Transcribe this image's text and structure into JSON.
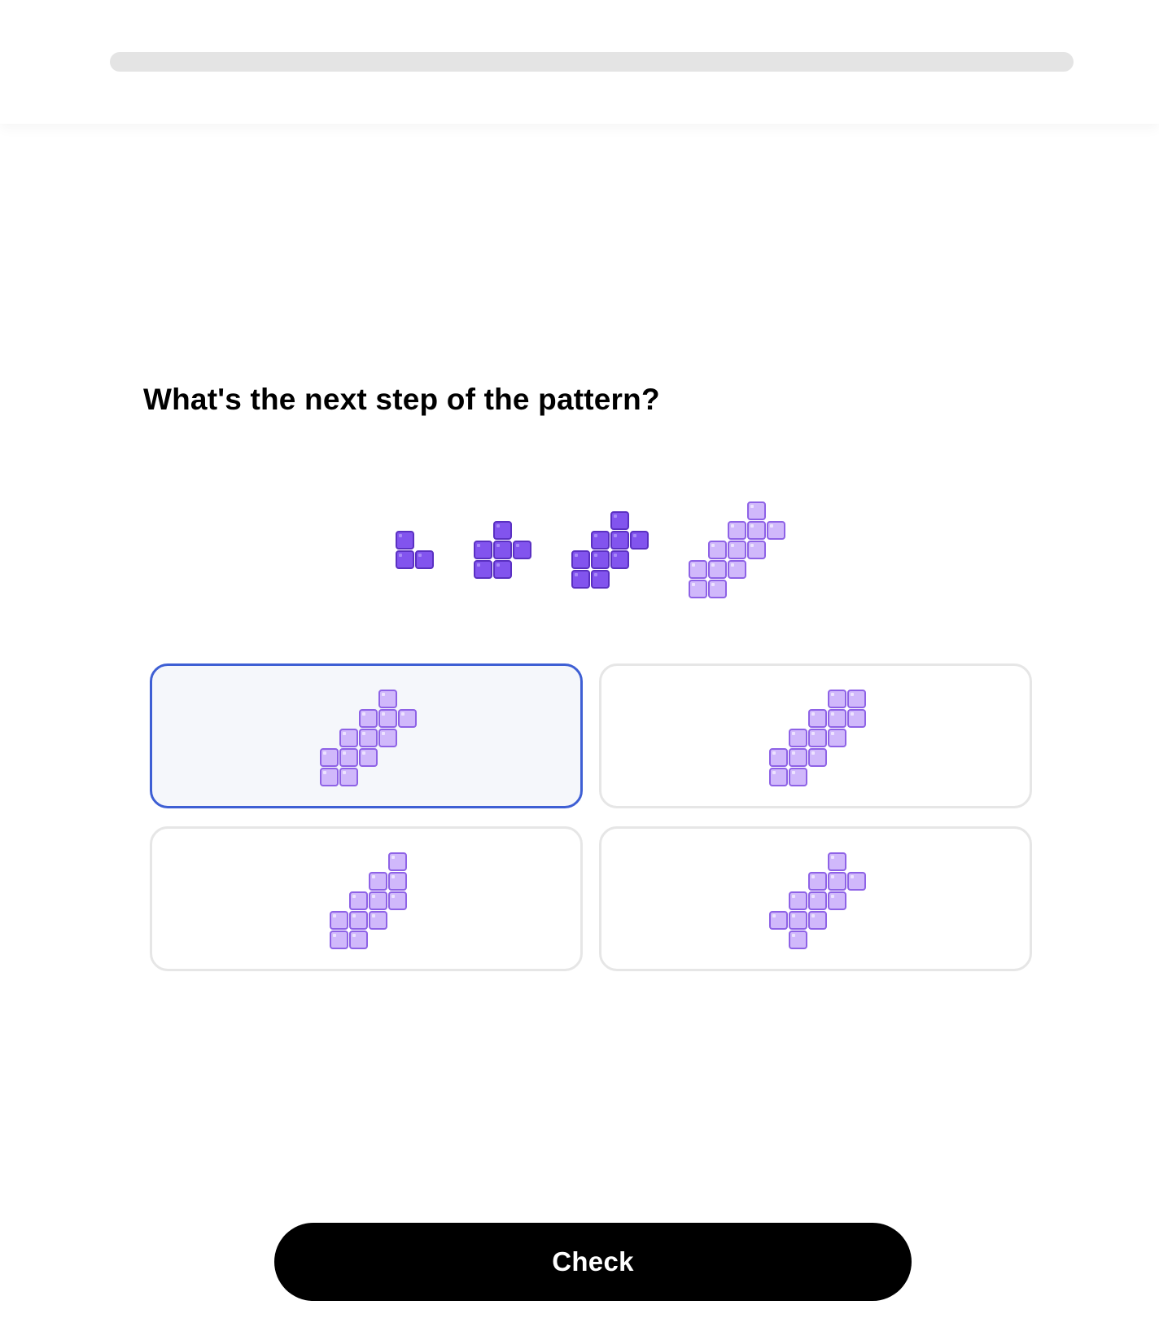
{
  "progress": {
    "fraction": 0
  },
  "question": {
    "text": "What's the next step of the pattern?"
  },
  "colors": {
    "dark_block": "#8254ee",
    "light_block": "#d0b8fb",
    "selected_border": "#3e5fd4"
  },
  "pattern": {
    "steps": [
      {
        "style": "dark",
        "cells": [
          [
            0,
            0
          ],
          [
            0,
            1
          ],
          [
            1,
            1
          ]
        ]
      },
      {
        "style": "dark",
        "cells": [
          [
            1,
            0
          ],
          [
            0,
            1
          ],
          [
            1,
            1
          ],
          [
            2,
            1
          ],
          [
            0,
            2
          ],
          [
            1,
            2
          ]
        ]
      },
      {
        "style": "dark",
        "cells": [
          [
            2,
            0
          ],
          [
            1,
            1
          ],
          [
            2,
            1
          ],
          [
            3,
            1
          ],
          [
            0,
            2
          ],
          [
            1,
            2
          ],
          [
            2,
            2
          ],
          [
            0,
            3
          ],
          [
            1,
            3
          ]
        ]
      },
      {
        "style": "light",
        "cells": [
          [
            3,
            0
          ],
          [
            2,
            1
          ],
          [
            3,
            1
          ],
          [
            4,
            1
          ],
          [
            1,
            2
          ],
          [
            2,
            2
          ],
          [
            3,
            2
          ],
          [
            0,
            3
          ],
          [
            1,
            3
          ],
          [
            2,
            3
          ],
          [
            0,
            4
          ],
          [
            1,
            4
          ]
        ]
      }
    ]
  },
  "options": [
    {
      "selected": true,
      "style": "light",
      "cells": [
        [
          3,
          0
        ],
        [
          2,
          1
        ],
        [
          3,
          1
        ],
        [
          4,
          1
        ],
        [
          1,
          2
        ],
        [
          2,
          2
        ],
        [
          3,
          2
        ],
        [
          0,
          3
        ],
        [
          1,
          3
        ],
        [
          2,
          3
        ],
        [
          0,
          4
        ],
        [
          1,
          4
        ]
      ]
    },
    {
      "selected": false,
      "style": "light",
      "cells": [
        [
          3,
          0
        ],
        [
          4,
          0
        ],
        [
          2,
          1
        ],
        [
          3,
          1
        ],
        [
          4,
          1
        ],
        [
          1,
          2
        ],
        [
          2,
          2
        ],
        [
          3,
          2
        ],
        [
          0,
          3
        ],
        [
          1,
          3
        ],
        [
          2,
          3
        ],
        [
          0,
          4
        ],
        [
          1,
          4
        ]
      ]
    },
    {
      "selected": false,
      "style": "light",
      "cells": [
        [
          3,
          0
        ],
        [
          2,
          1
        ],
        [
          3,
          1
        ],
        [
          1,
          2
        ],
        [
          2,
          2
        ],
        [
          3,
          2
        ],
        [
          0,
          3
        ],
        [
          1,
          3
        ],
        [
          2,
          3
        ],
        [
          0,
          4
        ],
        [
          1,
          4
        ]
      ]
    },
    {
      "selected": false,
      "style": "light",
      "cells": [
        [
          3,
          0
        ],
        [
          2,
          1
        ],
        [
          3,
          1
        ],
        [
          4,
          1
        ],
        [
          1,
          2
        ],
        [
          2,
          2
        ],
        [
          3,
          2
        ],
        [
          0,
          3
        ],
        [
          1,
          3
        ],
        [
          2,
          3
        ],
        [
          1,
          4
        ]
      ]
    }
  ],
  "check_button": {
    "label": "Check"
  }
}
